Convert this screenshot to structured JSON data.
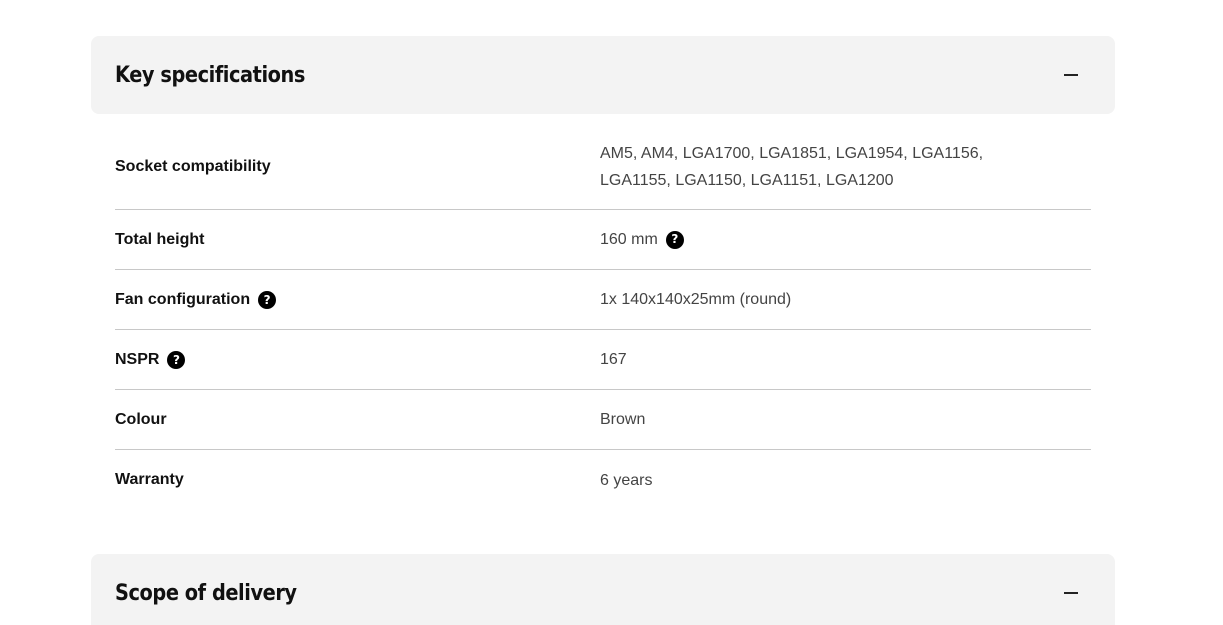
{
  "sections": [
    {
      "title": "Key specifications",
      "icon": "minus-icon"
    },
    {
      "title": "Scope of delivery",
      "icon": "minus-icon"
    }
  ],
  "specs": [
    {
      "label": "Socket compatibility",
      "value": "AM5, AM4, LGA1700, LGA1851, LGA1954, LGA1156, LGA1155, LGA1150, LGA1151, LGA1200"
    },
    {
      "label": "Total height",
      "value": "160 mm"
    },
    {
      "label": "Fan configuration",
      "value": "1x 140x140x25mm (round)"
    },
    {
      "label": "NSPR",
      "value": "167"
    },
    {
      "label": "Colour",
      "value": "Brown"
    },
    {
      "label": "Warranty",
      "value": "6 years"
    }
  ],
  "help_glyph": "?"
}
